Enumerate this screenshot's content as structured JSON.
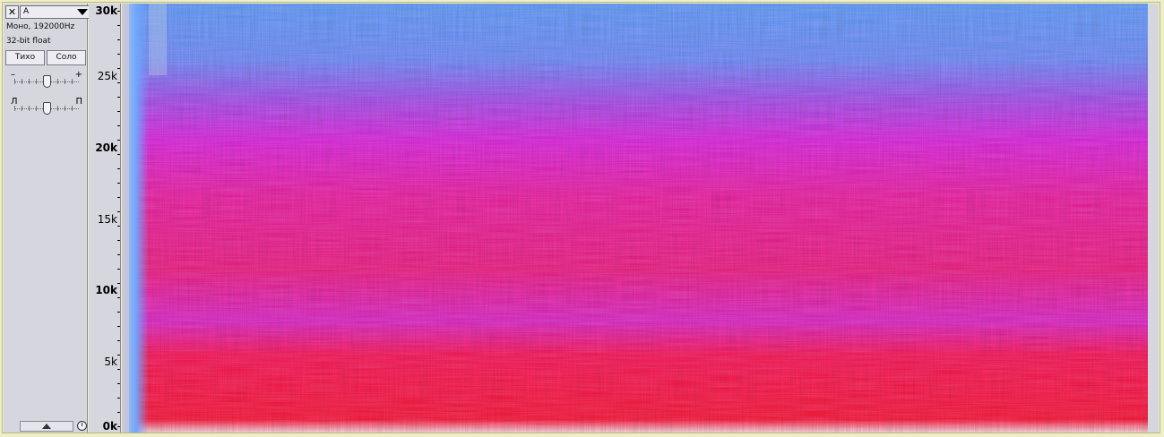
{
  "track": {
    "close_label": "✕",
    "name": "A",
    "format": "Моно, 192000Hz",
    "bit_depth": "32-bit float",
    "mute_label": "Тихо",
    "solo_label": "Соло",
    "gain_minus": "–",
    "gain_plus": "+",
    "pan_left": "Л",
    "pan_right": "П"
  },
  "ruler": {
    "ticks": [
      {
        "label": "30k",
        "major": true
      },
      {
        "label": "25k",
        "major": false
      },
      {
        "label": "20k",
        "major": true
      },
      {
        "label": "15k",
        "major": false
      },
      {
        "label": "10k",
        "major": true
      },
      {
        "label": "5k",
        "major": false
      },
      {
        "label": "0k",
        "major": true
      }
    ]
  },
  "colors": {
    "low_energy": "#5aa0ff",
    "mid_energy": "#e020e0",
    "high_energy": "#ff1030"
  }
}
